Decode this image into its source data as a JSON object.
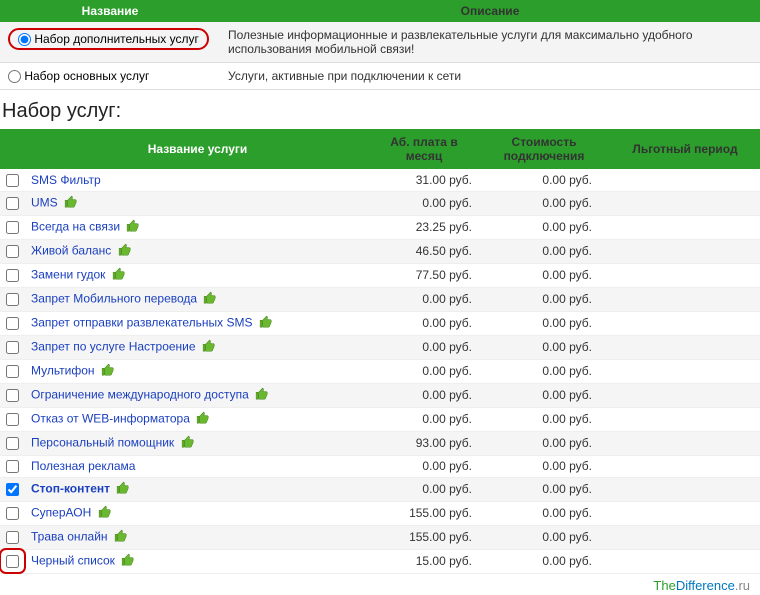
{
  "top": {
    "headers": {
      "name": "Название",
      "desc": "Описание"
    },
    "rows": [
      {
        "name": "Набор дополнительных услуг",
        "desc": "Полезные информационные и развлекательные услуги для максимально удобного использования мобильной связи!",
        "selected": true,
        "highlighted": true
      },
      {
        "name": "Набор основных услуг",
        "desc": "Услуги, активные при подключении к сети",
        "selected": false,
        "highlighted": false
      }
    ]
  },
  "section_title": "Набор услуг:",
  "svc": {
    "headers": {
      "name": "Название услуги",
      "fee": "Аб. плата в месяц",
      "cost": "Стоимость подключения",
      "period": "Льготный период"
    },
    "rows": [
      {
        "name": "SMS Фильтр",
        "fee": "31.00 руб.",
        "cost": "0.00 руб.",
        "icon": false,
        "checked": false,
        "bold": false
      },
      {
        "name": "UMS",
        "fee": "0.00 руб.",
        "cost": "0.00 руб.",
        "icon": true,
        "checked": false,
        "bold": false
      },
      {
        "name": "Всегда на связи",
        "fee": "23.25 руб.",
        "cost": "0.00 руб.",
        "icon": true,
        "checked": false,
        "bold": false
      },
      {
        "name": "Живой баланс",
        "fee": "46.50 руб.",
        "cost": "0.00 руб.",
        "icon": true,
        "checked": false,
        "bold": false
      },
      {
        "name": "Замени гудок",
        "fee": "77.50 руб.",
        "cost": "0.00 руб.",
        "icon": true,
        "checked": false,
        "bold": false
      },
      {
        "name": "Запрет Мобильного перевода",
        "fee": "0.00 руб.",
        "cost": "0.00 руб.",
        "icon": true,
        "checked": false,
        "bold": false
      },
      {
        "name": "Запрет отправки развлекательных SMS",
        "fee": "0.00 руб.",
        "cost": "0.00 руб.",
        "icon": true,
        "checked": false,
        "bold": false
      },
      {
        "name": "Запрет по услуге Настроение",
        "fee": "0.00 руб.",
        "cost": "0.00 руб.",
        "icon": true,
        "checked": false,
        "bold": false
      },
      {
        "name": "Мультифон",
        "fee": "0.00 руб.",
        "cost": "0.00 руб.",
        "icon": true,
        "checked": false,
        "bold": false
      },
      {
        "name": "Ограничение международного доступа",
        "fee": "0.00 руб.",
        "cost": "0.00 руб.",
        "icon": true,
        "checked": false,
        "bold": false
      },
      {
        "name": "Отказ от WEB-информатора",
        "fee": "0.00 руб.",
        "cost": "0.00 руб.",
        "icon": true,
        "checked": false,
        "bold": false
      },
      {
        "name": "Персональный помощник",
        "fee": "93.00 руб.",
        "cost": "0.00 руб.",
        "icon": true,
        "checked": false,
        "bold": false
      },
      {
        "name": "Полезная реклама",
        "fee": "0.00 руб.",
        "cost": "0.00 руб.",
        "icon": false,
        "checked": false,
        "bold": false
      },
      {
        "name": "Стоп-контент",
        "fee": "0.00 руб.",
        "cost": "0.00 руб.",
        "icon": true,
        "checked": true,
        "bold": true
      },
      {
        "name": "СуперАОН",
        "fee": "155.00 руб.",
        "cost": "0.00 руб.",
        "icon": true,
        "checked": false,
        "bold": false
      },
      {
        "name": "Трава онлайн",
        "fee": "155.00 руб.",
        "cost": "0.00 руб.",
        "icon": true,
        "checked": false,
        "bold": false
      },
      {
        "name": "Черный список",
        "fee": "15.00 руб.",
        "cost": "0.00 руб.",
        "icon": true,
        "checked": false,
        "bold": false
      }
    ]
  },
  "footer": {
    "a": "The",
    "b": "Difference",
    "c": ".ru"
  },
  "highlight_last_checkbox": true
}
